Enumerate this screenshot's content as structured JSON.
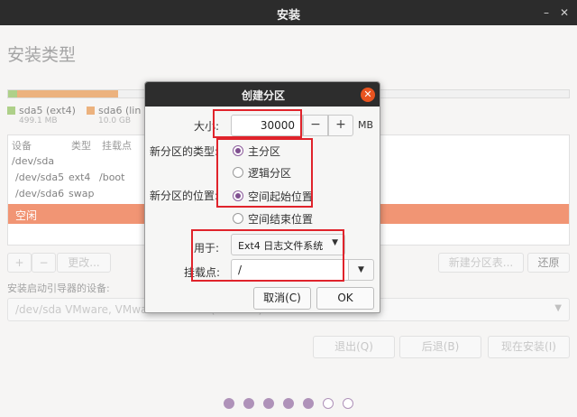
{
  "window": {
    "title": "安装",
    "minimize_glyph": "–",
    "close_glyph": "✕",
    "icons": [
      "minimize-icon",
      "close-icon"
    ]
  },
  "page": {
    "title": "安装类型"
  },
  "colors": {
    "accent": "#e95420",
    "partition_sda5": "#7cb342",
    "partition_sda6": "#e0832f",
    "radio": "#7f4f8f",
    "highlight": "#e0232b"
  },
  "disk_bar": {
    "legend": [
      {
        "name": "sda5 (ext4)",
        "size": "499.1 MB",
        "color": "#7cb342"
      },
      {
        "name": "sda6 (lin",
        "size": "10.0 GB",
        "color": "#e0832f"
      }
    ]
  },
  "partition_table": {
    "headers": [
      "设备",
      "类型",
      "挂载点"
    ],
    "rows": [
      {
        "device": "/dev/sda",
        "type": "",
        "mount": ""
      },
      {
        "device": "/dev/sda5",
        "type": "ext4",
        "mount": "/boot"
      },
      {
        "device": "/dev/sda6",
        "type": "swap",
        "mount": ""
      }
    ],
    "selected_row": "空闲"
  },
  "table_buttons": {
    "add": "+",
    "remove": "−",
    "change": "更改...",
    "new_table": "新建分区表...",
    "revert": "还原"
  },
  "boot_loader": {
    "label": "安装启动引导器的设备:",
    "value": "/dev/sda   VMware, VMware Virtual S (34.4 GB)",
    "arrow": "▼"
  },
  "nav": {
    "quit": "退出(Q)",
    "back": "后退(B)",
    "install_now": "现在安装(I)"
  },
  "progress": {
    "total_steps": 7,
    "current_step": 5
  },
  "dialog": {
    "title": "创建分区",
    "close_glyph": "✕",
    "size_label": "大小:",
    "size_value": "30000",
    "size_unit": "MB",
    "minus": "−",
    "plus": "+",
    "type_label": "新分区的类型:",
    "type_options": [
      {
        "label": "主分区",
        "selected": true
      },
      {
        "label": "逻辑分区",
        "selected": false
      }
    ],
    "location_label": "新分区的位置:",
    "location_options": [
      {
        "label": "空间起始位置",
        "selected": true
      },
      {
        "label": "空间结束位置",
        "selected": false
      }
    ],
    "use_as_label": "用于:",
    "use_as_value": "Ext4 日志文件系统",
    "combo_arrow": "▼",
    "mount_label": "挂载点:",
    "mount_value": "/",
    "cancel": "取消(C)",
    "ok": "OK"
  }
}
